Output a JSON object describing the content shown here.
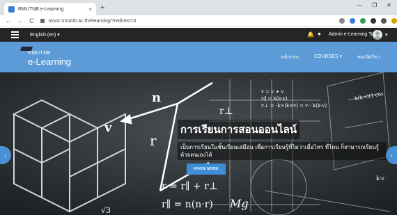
{
  "browser": {
    "tab_title": "RMUTNB e-Learning",
    "tab_close": "×",
    "new_tab": "+",
    "window_controls": [
      "—",
      "❐",
      "✕"
    ],
    "url": "mooc.rmutnb.ac.th/elearning/?redirect=0",
    "nav": {
      "back": "←",
      "forward": "→",
      "reload": "C"
    },
    "extension_colors": [
      "#888888",
      "#3a7bd5",
      "#2e9e57",
      "#333333",
      "#555555",
      "#d9a400"
    ]
  },
  "header": {
    "language": "English (en) ▾",
    "user_name": "Admin e-Learning Tools",
    "user_caret": "▾",
    "bell_icon": "bell-icon",
    "chat_icon": "chat-icon"
  },
  "brand": {
    "logo_small": "RMUTNB",
    "logo_big": "e-Learning",
    "menu": [
      "หน้าแรก",
      "COURSES ▾",
      "ขอเปิดวิชา"
    ]
  },
  "hero": {
    "title": "การเรียนการสอนออนไลน์",
    "subtitle": "เป็นการเรียนในชั้นเรียนเสมือน เพื่อการเรียนรู้ที่ไม่ว่าเมื่อไหร่ ที่ไหน ก็สามารถเรียนรู้ด้วยตนเองได้",
    "button": "KNOW MORE",
    "prev": "‹",
    "next": "›",
    "formulas": {
      "v": "v",
      "n": "n",
      "r": "r",
      "perp": "r⊥",
      "eq1": "r = r∥ + r⊥",
      "eq2": "r∥ = n(n·r)",
      "mg": "Mg",
      "sqrt": "√3",
      "vec1": "v = v + v",
      "vec2": "v∥ = k(k·v)",
      "vec3": "v⊥ = -k×(k×v) = v - k(k·v)",
      "side": "k(k·v)(1-cos",
      "kv": "k·v"
    }
  },
  "colors": {
    "brand_blue": "#5d9bd8",
    "header_dark": "#252525",
    "button_blue": "#3d8ed6"
  }
}
